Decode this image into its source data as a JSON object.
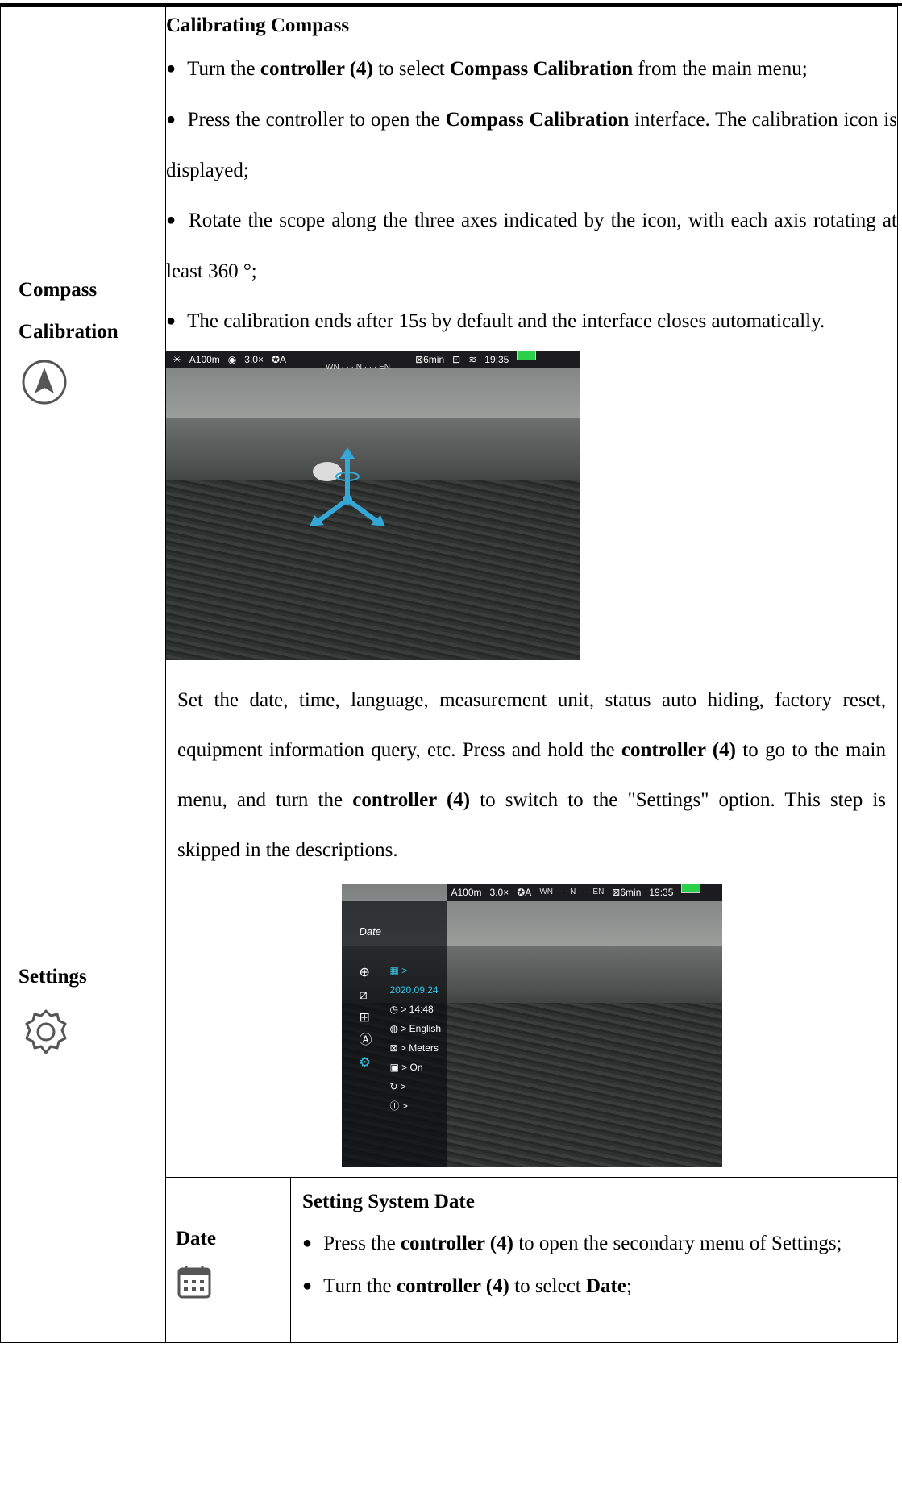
{
  "compass": {
    "side_title_1": "Compass",
    "side_title_2": "Calibration",
    "heading": "Calibrating Compass",
    "b1_pre": "Turn the ",
    "b1_bold1": "controller (4)",
    "b1_mid": " to select ",
    "b1_bold2": "Compass Calibration",
    "b1_post": " from the main menu;",
    "b2_pre": "Press the controller to open the ",
    "b2_bold": "Compass Calibration",
    "b2_post": " interface. The calibration icon is displayed;",
    "b3": "Rotate the scope along the three axes indicated by the icon, with each axis rotating at least 360 °;",
    "b4": "The calibration ends after 15s by default and the interface closes automatically.",
    "hud": {
      "range": "A100m",
      "zoom": "3.0×",
      "mode": "A",
      "compass": "WN · · · N · · · EN",
      "timer": "6min",
      "time": "19:35"
    }
  },
  "settings": {
    "side_title": "Settings",
    "p_pre": "Set the date, time, language, measurement unit, status auto hiding, factory reset, equipment information query, etc. Press and hold the ",
    "p_bold1": "controller (4)",
    "p_mid": " to go to the main menu, and turn the ",
    "p_bold2": "controller (4)",
    "p_post": " to switch to the \"Settings\" option. This step is skipped in the descriptions.",
    "hud": {
      "range": "A100m",
      "zoom": "3.0×",
      "mode": "A",
      "compass": "WN · · · N · · · EN",
      "timer": "6min",
      "time": "19:35"
    },
    "menu": {
      "title": "Date",
      "items": [
        "> 2020.09.24",
        "> 14:48",
        "> English",
        "> Meters",
        "> On",
        ">",
        ">"
      ]
    }
  },
  "date": {
    "side_title": "Date",
    "heading": "Setting System Date",
    "b1_pre": "Press the ",
    "b1_bold": "controller (4)",
    "b1_post": " to open the secondary menu of Settings;",
    "b2_pre": "Turn the ",
    "b2_bold": "controller (4)",
    "b2_mid": " to select ",
    "b2_bold2": "Date",
    "b2_post": ";"
  }
}
